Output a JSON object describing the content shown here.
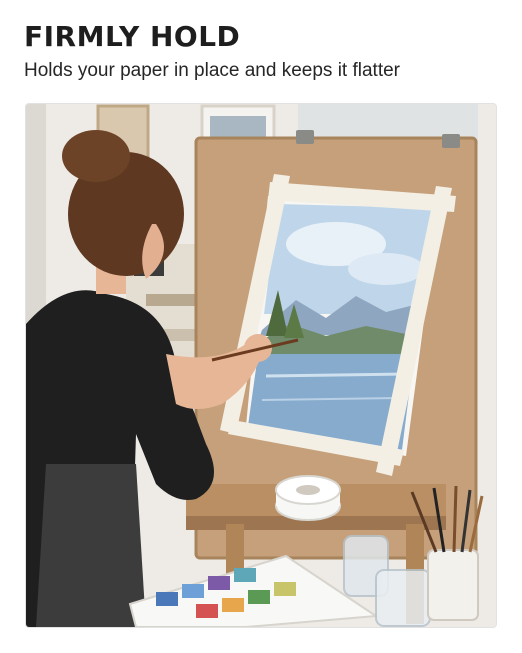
{
  "header": {
    "title": "FIRMLY HOLD",
    "subtitle": "Holds your paper in place and keeps it flatter"
  },
  "image": {
    "subject": "artist-painting-watercolor-on-easel",
    "colors": {
      "wall": "#f1efeb",
      "easel": "#c6a27a",
      "tape": "#f4f1e8",
      "sky": "#bcd4e8",
      "water": "#7fa6c9",
      "mountain": "#8aa2bd",
      "shirt": "#222222",
      "hair": "#6a3f26",
      "skin": "#e7b99a"
    }
  }
}
